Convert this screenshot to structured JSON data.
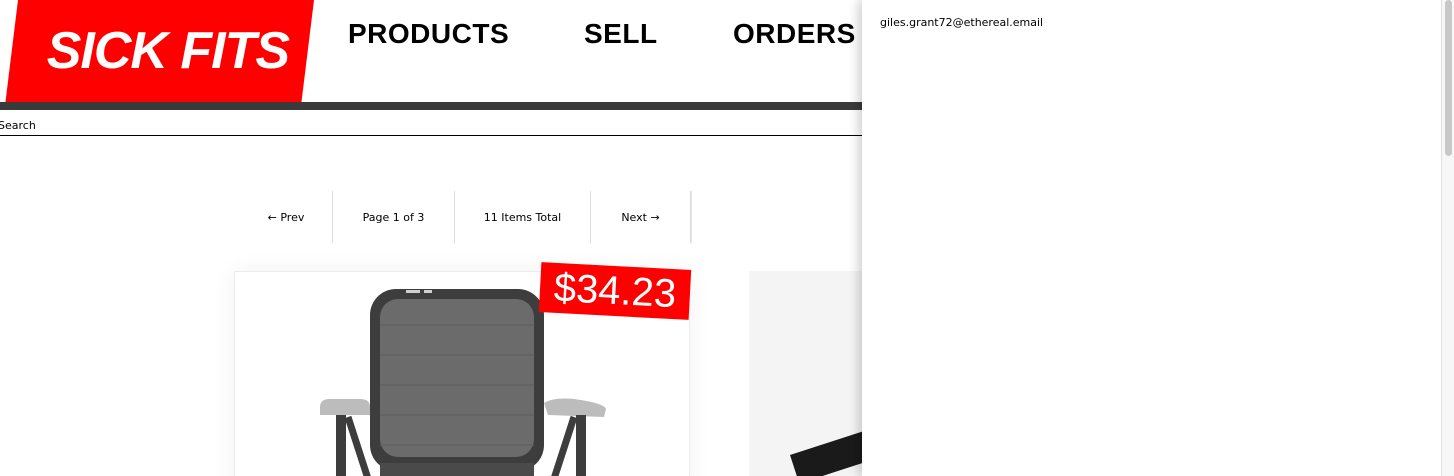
{
  "header": {
    "logo": "SICK FITS",
    "nav": [
      {
        "label": "PRODUCTS"
      },
      {
        "label": "SELL"
      },
      {
        "label": "ORDERS"
      }
    ]
  },
  "search": {
    "placeholder": "Search"
  },
  "pagination": {
    "prev_label": "← Prev",
    "page_label": "Page 1 of 3",
    "total_label": "11 Items Total",
    "next_label": "Next →"
  },
  "products": [
    {
      "price": "$34.23",
      "image": "chair-image"
    },
    {
      "image": "product-image"
    }
  ],
  "account_panel": {
    "email": "giles.grant72@ethereal.email"
  },
  "colors": {
    "brand_red": "#ff0000",
    "header_bar": "#3a3a3a"
  }
}
